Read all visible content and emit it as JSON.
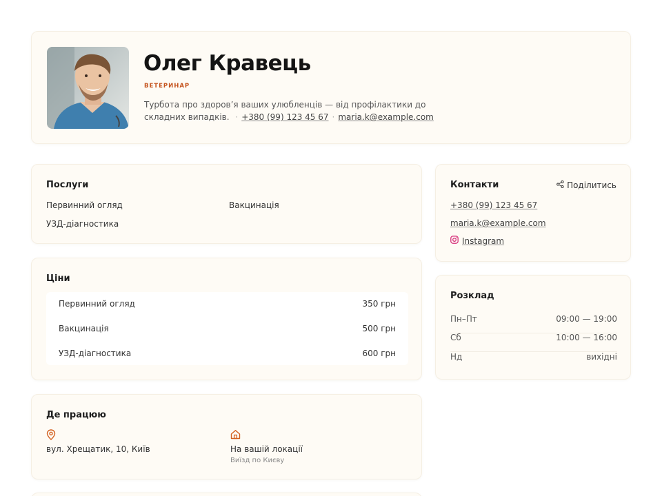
{
  "profile": {
    "name": "Олег Кравець",
    "role": "ВЕТЕРИНАР",
    "bio": "Турбота про здоров’я ваших улюбленців — від профілактики до складних випадків.",
    "bio_sep1": "·",
    "phone": "+380 (99) 123 45 67",
    "bio_sep2": "·",
    "email": "maria.k@example.com"
  },
  "services": {
    "title": "Послуги",
    "items": [
      "Первинний огляд",
      "Вакцинація",
      "УЗД-діагностика"
    ]
  },
  "prices": {
    "title": "Ціни",
    "rows": [
      {
        "name": "Первинний огляд",
        "price": "350 грн"
      },
      {
        "name": "Вакцинація",
        "price": "500 грн"
      },
      {
        "name": "УЗД-діагностика",
        "price": "600 грн"
      }
    ]
  },
  "where": {
    "title": "Де працюю",
    "address": "вул. Хрещатик, 10, Київ",
    "onsite_label": "На вашій локації",
    "onsite_sub": "Виїзд по Києву",
    "icons": {
      "address": "map-pin-icon",
      "onsite": "home-icon"
    }
  },
  "contacts": {
    "title": "Контакти",
    "share_label": "Поділитись",
    "phone": "+380 (99) 123 45 67",
    "email": "maria.k@example.com",
    "instagram": "Instagram",
    "icons": {
      "share": "share-icon",
      "instagram": "instagram-icon"
    }
  },
  "schedule": {
    "title": "Розклад",
    "rows": [
      {
        "day": "Пн–Пт",
        "hours": "09:00 — 19:00"
      },
      {
        "day": "Сб",
        "hours": "10:00 — 16:00"
      },
      {
        "day": "Нд",
        "hours": "вихідні"
      }
    ]
  },
  "colors": {
    "accent": "#c4521c",
    "card_bg": "#fefbf5",
    "instagram": "#d6307a"
  }
}
